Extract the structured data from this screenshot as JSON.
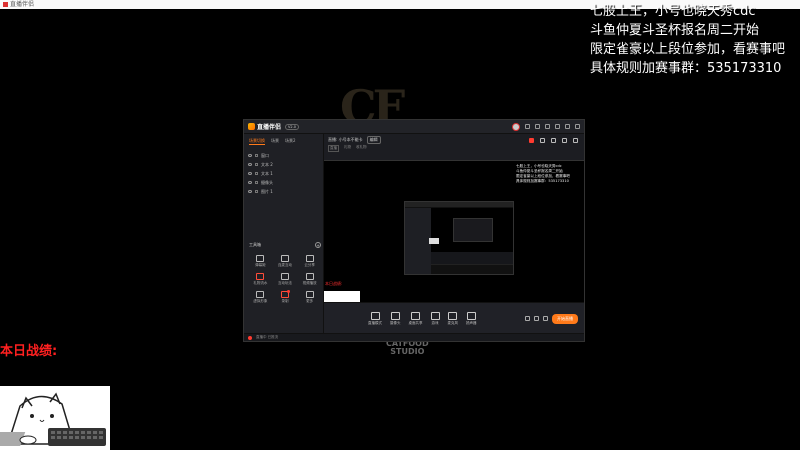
{
  "window": {
    "title": "直播伴侣"
  },
  "overlay": {
    "lines": [
      "七股上王，小号也晓天秀cdc",
      "斗鱼仲夏斗圣杯报名周二开始",
      "限定雀豪以上段位参加，看赛事吧",
      "具体规则加赛事群：535173310"
    ]
  },
  "watermark": {
    "studio_line1": "CATFOOD",
    "studio_line2": "STUDIO"
  },
  "day_label": "本日战绩:",
  "app": {
    "name": "直播伴侣",
    "version": "V2.0",
    "sidebar": {
      "tabs": [
        "场景切换",
        "场景",
        "场景2"
      ],
      "layers": [
        "窗口",
        "文本 2",
        "文本 1",
        "摄像头",
        "图片 1"
      ],
      "tools_title": "工具箱",
      "tools": [
        "弹幕姬",
        "连麦互动",
        "云分享",
        "礼物流水",
        "互动玩法",
        "视频播放",
        "虚拟形象",
        "录制",
        "更多"
      ]
    },
    "main": {
      "title": "直播: 小号本不能卡",
      "edit_label": "编辑",
      "subtitle": [
        "直播",
        "礼物",
        "收礼物"
      ],
      "preview_text": [
        "七股上王，小号也晓天秀cdc",
        "斗鱼仲夏斗圣杯报名周二开始",
        "限定雀豪以上段位参加，看赛事吧",
        "具体规则加赛事群：535173310"
      ],
      "red_label": "本日战绩:",
      "bottom_tools": [
        "直播模式",
        "摄像头",
        "桌面共享",
        "游戏",
        "麦克风",
        "扬声器"
      ],
      "live_button": "开始直播"
    },
    "statusbar": "直播中 已推流"
  }
}
